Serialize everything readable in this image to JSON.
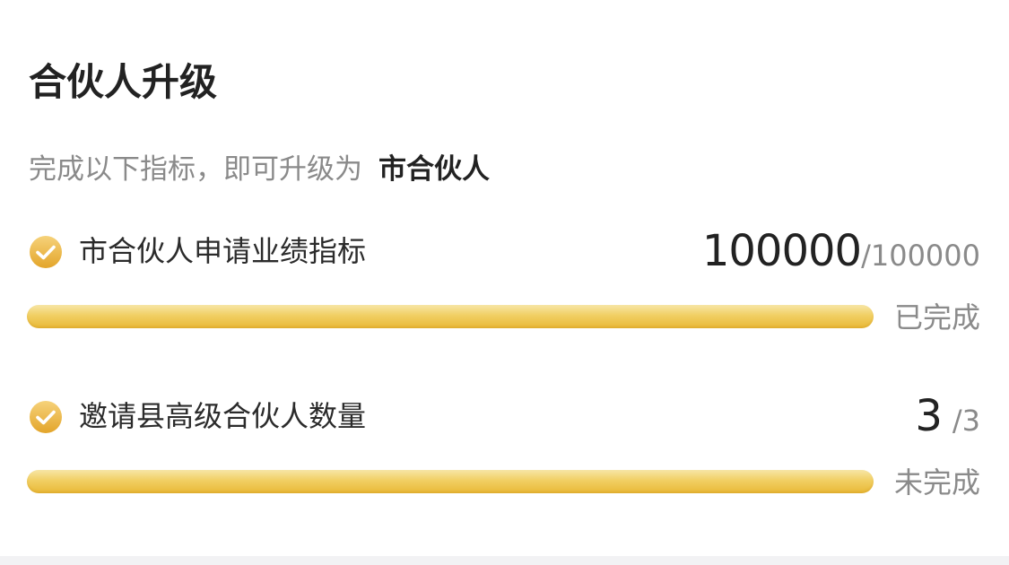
{
  "card": {
    "title": "合伙人升级",
    "subtitle_prefix": "完成以下指标，即可升级为",
    "target_level": "市合伙人"
  },
  "criteria": [
    {
      "label": "市合伙人申请业绩指标",
      "current": "100000",
      "total": "/100000",
      "status": "已完成",
      "progress_fraction": 1.0,
      "icon": "check-circle-icon"
    },
    {
      "label": "邀请县高级合伙人数量",
      "current": "3",
      "total": "/3",
      "status": "未完成",
      "progress_fraction": 1.0,
      "icon": "check-circle-icon"
    }
  ],
  "colors": {
    "accent_gold": "#f1cf63",
    "check_gold": "#eab53a",
    "title_text": "#222222",
    "muted_text": "#8a8a8a"
  }
}
